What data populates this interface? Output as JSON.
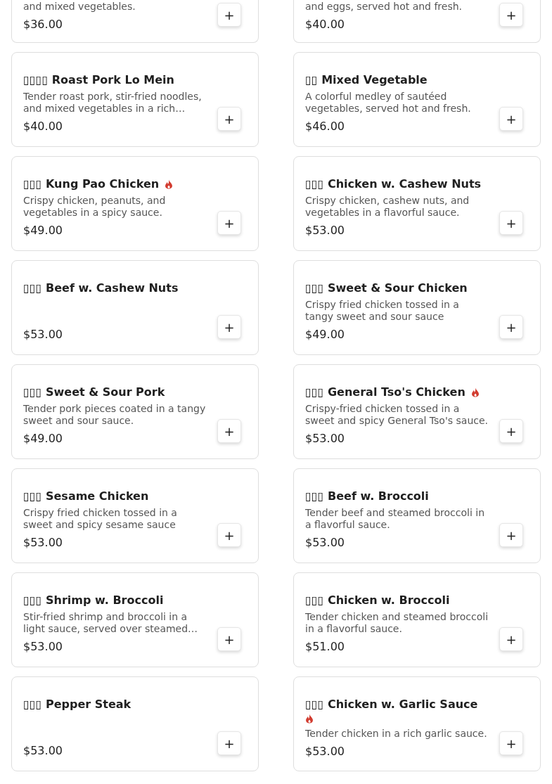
{
  "partial_items": [
    {
      "description_tail": "and mixed vegetables.",
      "price": "$36.00",
      "add": "+"
    },
    {
      "description_tail": "and eggs, served hot and fresh.",
      "price": "$40.00",
      "add": "+"
    }
  ],
  "items": [
    {
      "name_zh": "▯▯▯▯",
      "name": "Roast Pork Lo Mein",
      "spicy": false,
      "description": "Tender roast pork, stir-fried noodles, and mixed vegetables in a rich…",
      "price": "$40.00",
      "add": "+"
    },
    {
      "name_zh": "▯▯",
      "name": "Mixed Vegetable",
      "spicy": false,
      "description": "A colorful medley of sautéed vegetables, served hot and fresh.",
      "price": "$46.00",
      "add": "+"
    },
    {
      "name_zh": "▯▯▯",
      "name": "Kung Pao Chicken",
      "spicy": true,
      "description": "Crispy chicken, peanuts, and vegetables in a spicy sauce.",
      "price": "$49.00",
      "add": "+"
    },
    {
      "name_zh": "▯▯▯",
      "name": "Chicken w. Cashew Nuts",
      "spicy": false,
      "description": "Crispy chicken, cashew nuts, and vegetables in a flavorful sauce.",
      "price": "$53.00",
      "add": "+"
    },
    {
      "name_zh": "▯▯▯",
      "name": "Beef w. Cashew Nuts",
      "spicy": false,
      "price": "$53.00",
      "add": "+"
    },
    {
      "name_zh": "▯▯▯",
      "name": "Sweet & Sour Chicken",
      "spicy": false,
      "description": "Crispy fried chicken tossed in a tangy sweet and sour sauce",
      "price": "$49.00",
      "add": "+"
    },
    {
      "name_zh": "▯▯▯",
      "name": "Sweet & Sour Pork",
      "spicy": false,
      "description": "Tender pork pieces coated in a tangy sweet and sour sauce.",
      "price": "$49.00",
      "add": "+"
    },
    {
      "name_zh": "▯▯▯",
      "name": "General Tso's Chicken",
      "spicy": true,
      "description": "Crispy-fried chicken tossed in a sweet and spicy General Tso's sauce.",
      "price": "$53.00",
      "add": "+"
    },
    {
      "name_zh": "▯▯▯",
      "name": "Sesame Chicken",
      "spicy": false,
      "description": "Crispy fried chicken tossed in a sweet and spicy sesame sauce",
      "price": "$53.00",
      "add": "+"
    },
    {
      "name_zh": "▯▯▯",
      "name": "Beef w. Broccoli",
      "spicy": false,
      "description": "Tender beef and steamed broccoli in a flavorful sauce.",
      "price": "$53.00",
      "add": "+"
    },
    {
      "name_zh": "▯▯▯",
      "name": "Shrimp w. Broccoli",
      "spicy": false,
      "description": "Stir-fried shrimp and broccoli in a light sauce, served over steamed…",
      "price": "$53.00",
      "add": "+"
    },
    {
      "name_zh": "▯▯▯",
      "name": "Chicken w. Broccoli",
      "spicy": false,
      "description": "Tender chicken and steamed broccoli in a flavorful sauce.",
      "price": "$51.00",
      "add": "+"
    },
    {
      "name_zh": "▯▯▯",
      "name": "Pepper Steak",
      "spicy": false,
      "price": "$53.00",
      "add": "+"
    },
    {
      "name_zh": "▯▯▯",
      "name": "Chicken w. Garlic Sauce",
      "spicy": true,
      "description": "Tender chicken in a rich garlic sauce.",
      "price": "$53.00",
      "add": "+"
    }
  ]
}
